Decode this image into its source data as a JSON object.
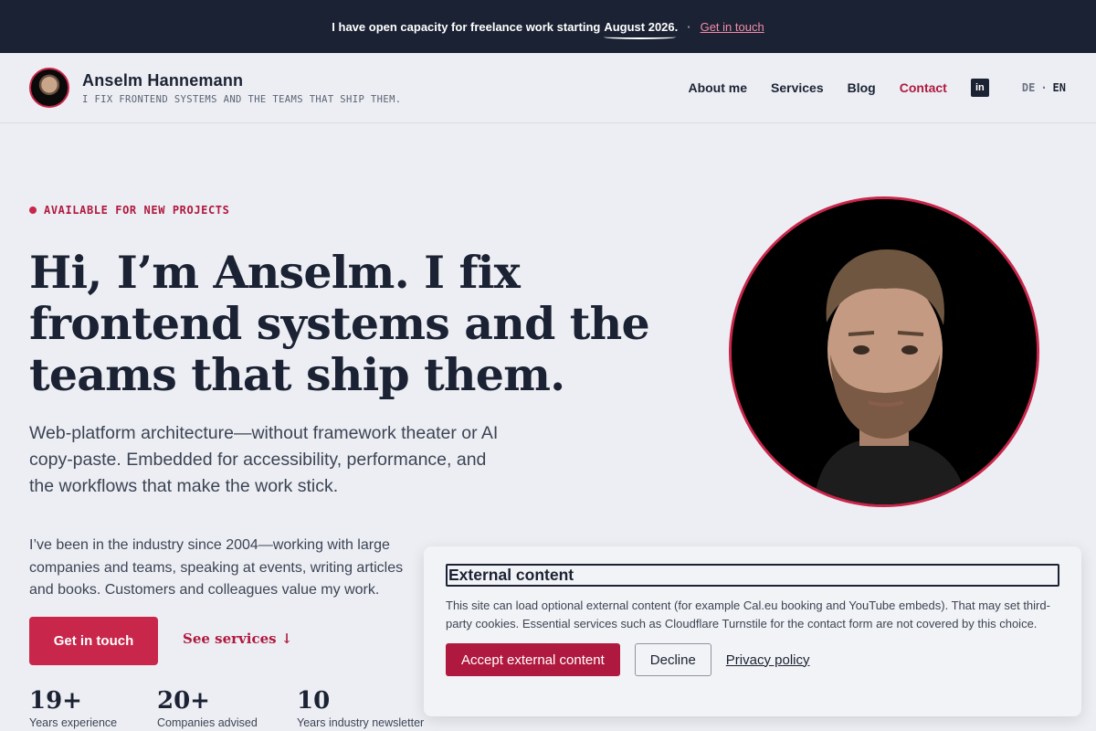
{
  "banner": {
    "text": "I have open capacity for freelance work starting",
    "date": "August 2026.",
    "separator": "·",
    "cta": "Get in touch"
  },
  "header": {
    "name": "Anselm Hannemann",
    "tagline": "I FIX FRONTEND SYSTEMS AND THE TEAMS THAT SHIP THEM.",
    "nav": [
      "About me",
      "Services",
      "Blog",
      "Contact"
    ],
    "active_nav": "Contact",
    "linkedin_label": "in",
    "lang": {
      "de": "DE",
      "separator": "·",
      "en": "EN",
      "active": "EN"
    }
  },
  "hero": {
    "eyebrow": "AVAILABLE FOR NEW PROJECTS",
    "headline": "Hi, I’m Anselm. I fix frontend systems and the teams that ship them.",
    "lead": "Web-platform architecture—without framework theater or AI copy-paste. Embedded for accessibility, performance, and the workflows that make the work stick.",
    "body": "I’ve been in the industry since 2004—working with large companies and teams, speaking at events, writing articles and books. Customers and colleagues value my work.",
    "cta_primary": "Get in touch",
    "cta_secondary": "See services ↓"
  },
  "stats": [
    {
      "value": "19+",
      "label": "Years experience"
    },
    {
      "value": "20+",
      "label": "Companies advised"
    },
    {
      "value": "10",
      "label": "Years industry newsletter"
    }
  ],
  "consent": {
    "title": "External content",
    "text": "This site can load optional external content (for example Cal.eu booking and YouTube embeds). That may set third-party cookies. Essential services such as Cloudflare Turnstile for the contact form are not covered by this choice.",
    "accept": "Accept external content",
    "decline": "Decline",
    "privacy": "Privacy policy"
  },
  "colors": {
    "accent": "#c8264a",
    "accent_dark": "#b0193f",
    "navy": "#1b2233",
    "background": "#eceef3"
  }
}
